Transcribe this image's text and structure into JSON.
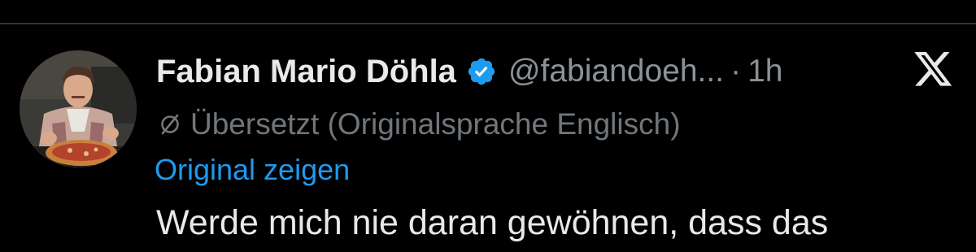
{
  "tweet": {
    "author": {
      "display_name": "Fabian Mario Döhla",
      "handle": "@fabiandoeh...",
      "verified": true
    },
    "separator": "·",
    "time": "1h",
    "translation_notice": "Übersetzt (Originalsprache Englisch)",
    "show_original_label": "Original zeigen",
    "text": "Werde mich nie daran gewöhnen, dass das"
  },
  "icons": {
    "verified": "verified-badge-icon",
    "platform": "x-logo-icon",
    "translate": "translate-icon"
  },
  "colors": {
    "background": "#000000",
    "primary_text": "#e7e9ea",
    "secondary_text": "#71767b",
    "link": "#1d9bf0",
    "verified": "#1d9bf0"
  }
}
